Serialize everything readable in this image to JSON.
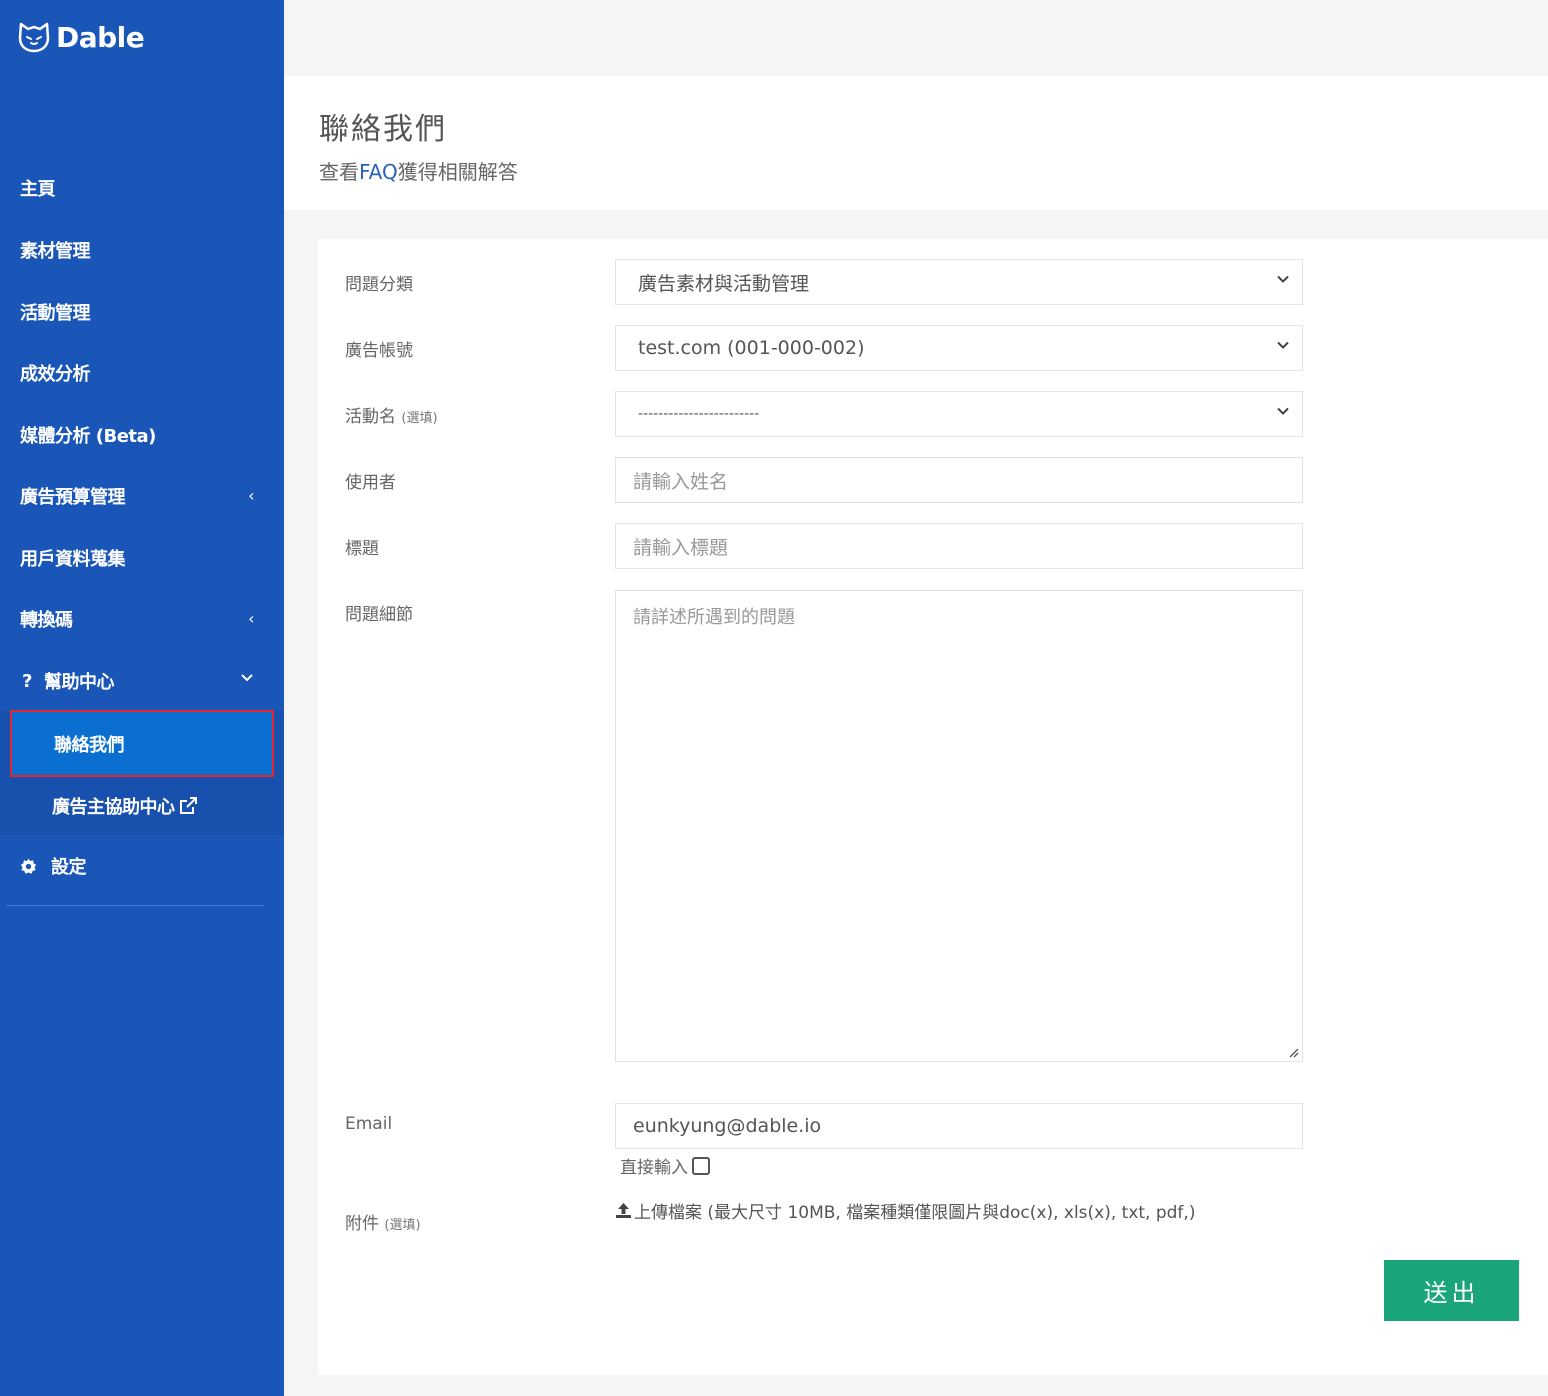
{
  "brand": {
    "name": "Dable",
    "color": "#1a56b8",
    "icon": "cat-logo-icon"
  },
  "sidebar": {
    "items": [
      {
        "label": "主頁"
      },
      {
        "label": "素材管理"
      },
      {
        "label": "活動管理"
      },
      {
        "label": "成效分析"
      },
      {
        "label": "媒體分析 (Beta)"
      },
      {
        "label": "廣告預算管理",
        "chevron": "‹"
      },
      {
        "label": "用戶資料蒐集"
      },
      {
        "label": "轉換碼",
        "chevron": "‹"
      },
      {
        "label": "幫助中心",
        "icon": "?",
        "chevron": "⌄"
      },
      {
        "label": "設定",
        "icon": "gear-icon"
      }
    ],
    "help_submenu": [
      {
        "label": "聯絡我們",
        "active": true
      },
      {
        "label": "廣告主協助中心",
        "icon": "external-link-icon"
      }
    ]
  },
  "header": {
    "title": "聯絡我們",
    "subtitle_prefix": "查看",
    "subtitle_link": "FAQ",
    "subtitle_suffix": "獲得相關解答"
  },
  "form": {
    "category": {
      "label": "問題分類",
      "value": "廣告素材與活動管理"
    },
    "account": {
      "label": "廣告帳號",
      "value": "test.com (001-000-002)"
    },
    "campaign": {
      "label": "活動名",
      "optional": "(選填)",
      "value": "------------------------"
    },
    "user": {
      "label": "使用者",
      "placeholder": "請輸入姓名"
    },
    "subject": {
      "label": "標題",
      "placeholder": "請輸入標題"
    },
    "details": {
      "label": "問題細節",
      "placeholder": "請詳述所遇到的問題"
    },
    "email": {
      "label": "Email",
      "value": "eunkyung@dable.io",
      "checkbox_label": "直接輸入"
    },
    "attachment": {
      "label": "附件",
      "optional": "(選填)",
      "upload_text": "上傳檔案 (最大尺寸 10MB, 檔案種類僅限圖片與doc(x), xls(x), txt, pdf,)"
    },
    "submit_label": "送出"
  },
  "colors": {
    "submit": "#1aa57a",
    "active_item": "#0a6fd0",
    "highlight_border": "#e0282e",
    "link": "#2a62b8"
  }
}
